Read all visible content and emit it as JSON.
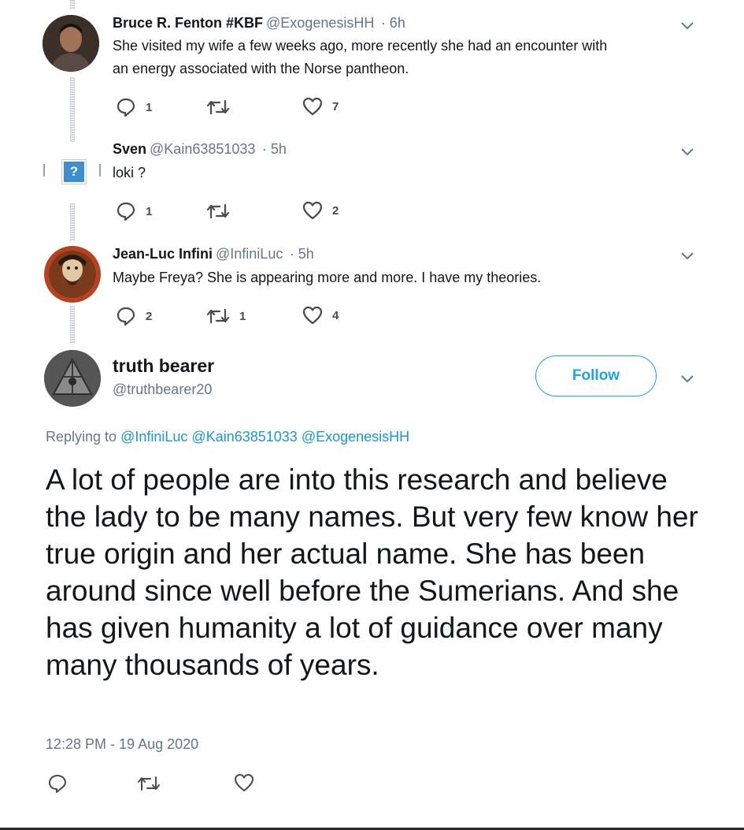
{
  "replies": [
    {
      "name": "Bruce R. Fenton #KBF",
      "handle": "@ExogenesisHH",
      "time": "· 6h",
      "text_lines": [
        "She visited my wife a few weeks ago, more recently she had an encounter with",
        "an energy associated with the Norse pantheon."
      ],
      "reply_count": "1",
      "retweet_count": "",
      "like_count": "7"
    },
    {
      "name": "Sven",
      "handle": "@Kain63851033",
      "time": "· 5h",
      "text_lines": [
        "loki ?"
      ],
      "reply_count": "1",
      "retweet_count": "",
      "like_count": "2"
    },
    {
      "name": "Jean-Luc Infini",
      "handle": "@InfiniLuc",
      "time": "· 5h",
      "text_lines": [
        "Maybe Freya? She is appearing more and more. I have my theories."
      ],
      "reply_count": "2",
      "retweet_count": "1",
      "like_count": "4"
    }
  ],
  "main_tweet": {
    "name": "truth bearer",
    "handle": "@truthbearer20",
    "follow_label": "Follow",
    "replying_prefix": "Replying to",
    "mentions": [
      "@InfiniLuc",
      "@Kain63851033",
      "@ExogenesisHH"
    ],
    "text": "A lot of people are into this research and believe the lady to be many names. But very few know her true origin and her actual name. She has been around since well before the Sumerians. And she has given humanity a lot of guidance over many many thousands of years.",
    "timestamp": "12:28 PM - 19 Aug 2020"
  },
  "placeholder_avatar_glyph": "?",
  "colors": {
    "accent": "#1da1f2",
    "mention": "#1b95e0",
    "secondary_text": "#657786",
    "text": "#14171a"
  },
  "icons": [
    "reply-icon",
    "retweet-icon",
    "like-icon",
    "chevron-down-icon"
  ]
}
